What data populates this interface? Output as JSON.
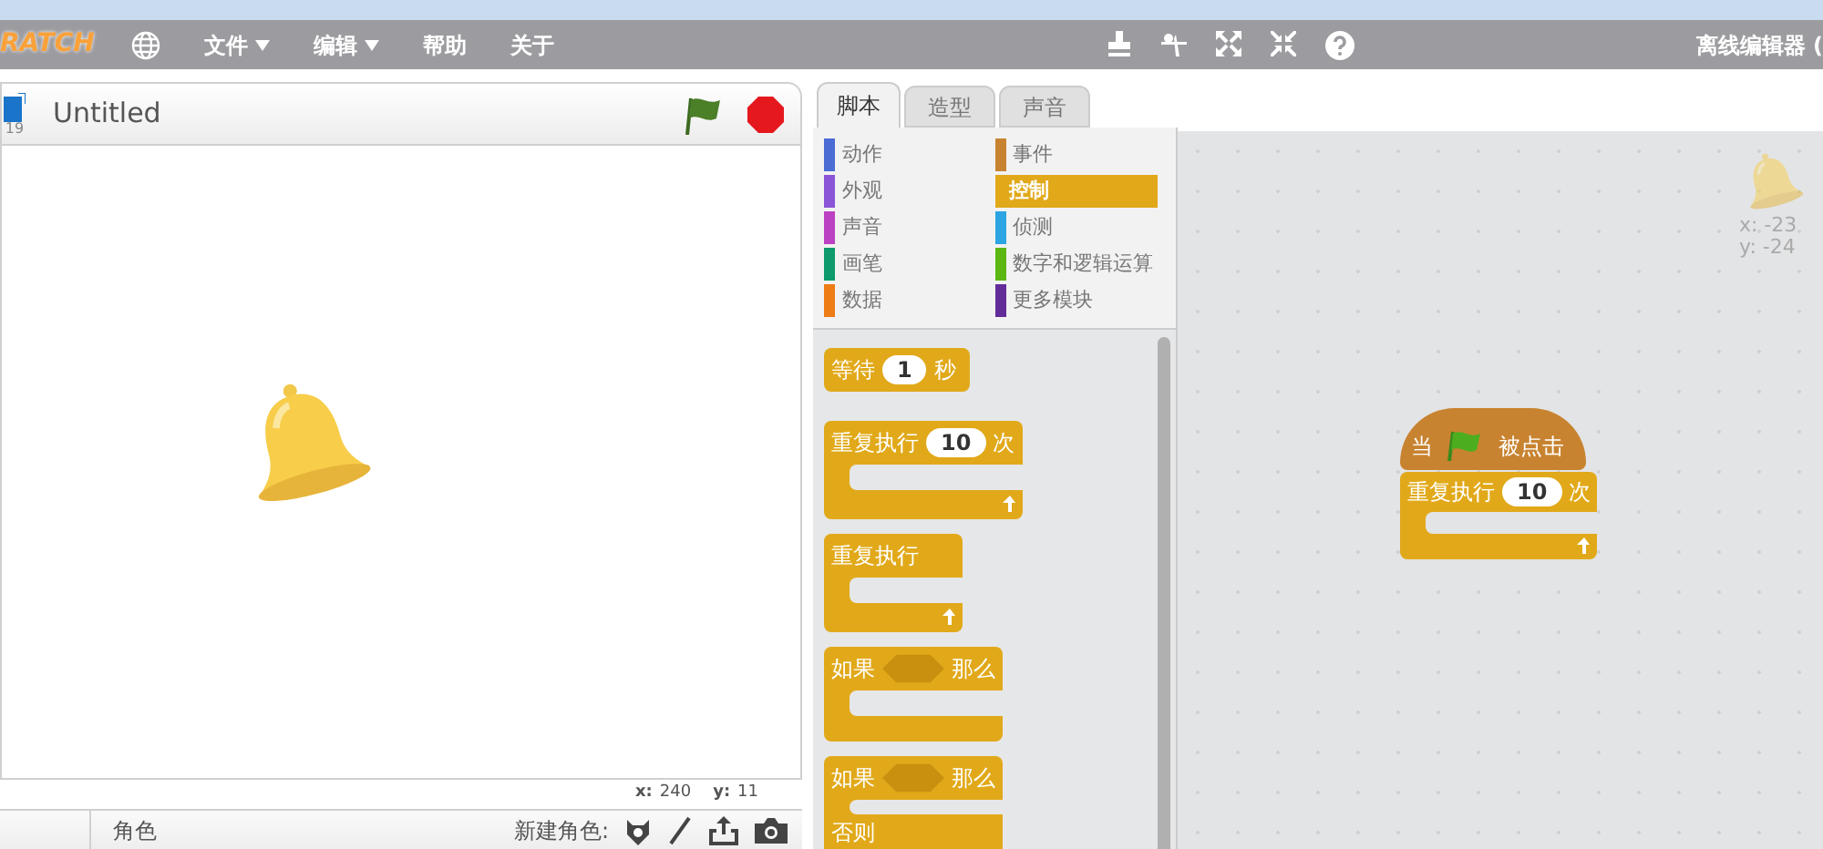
{
  "menu_bar": {
    "logo": "RATCH",
    "items": [
      {
        "label": "文件",
        "has_caret": true
      },
      {
        "label": "编辑",
        "has_caret": true
      },
      {
        "label": "帮助",
        "has_caret": false
      },
      {
        "label": "关于",
        "has_caret": false
      }
    ],
    "right_label": "离线编辑器 ("
  },
  "stage": {
    "title": "Untitled",
    "version": "19",
    "x_label": "x:",
    "x_value": "240",
    "y_label": "y:",
    "y_value": "11"
  },
  "sprite_bar": {
    "label": "角色",
    "new_sprite": "新建角色:"
  },
  "tabs": [
    {
      "label": "脚本",
      "selected": true
    },
    {
      "label": "造型",
      "selected": false
    },
    {
      "label": "声音",
      "selected": false
    }
  ],
  "categories": [
    {
      "label": "动作",
      "color": "#4a6cd4",
      "selected": false
    },
    {
      "label": "事件",
      "color": "#c88330",
      "selected": false
    },
    {
      "label": "外观",
      "color": "#8a55d7",
      "selected": false
    },
    {
      "label": "控制",
      "color": "#e1a91a",
      "selected": true
    },
    {
      "label": "声音",
      "color": "#bb42c3",
      "selected": false
    },
    {
      "label": "侦测",
      "color": "#2ca5e2",
      "selected": false
    },
    {
      "label": "画笔",
      "color": "#0e9a6c",
      "selected": false
    },
    {
      "label": "数字和逻辑运算",
      "color": "#5cb712",
      "selected": false
    },
    {
      "label": "数据",
      "color": "#ee7d16",
      "selected": false
    },
    {
      "label": "更多模块",
      "color": "#632d99",
      "selected": false
    }
  ],
  "palette_blocks": [
    {
      "kind": "stack",
      "label": "等待",
      "input": "1",
      "suffix": "秒"
    },
    {
      "kind": "c",
      "label": "重复执行",
      "input": "10",
      "suffix": "次"
    },
    {
      "kind": "c",
      "label": "重复执行"
    },
    {
      "kind": "if",
      "label": "如果",
      "suffix": "那么"
    },
    {
      "kind": "ifelse",
      "label": "如果",
      "suffix": "那么",
      "else_label": "否则"
    }
  ],
  "script": {
    "hat_label": "当",
    "hat_suffix": "被点击",
    "loop_label": "重复执行",
    "loop_input": "10",
    "loop_suffix": "次"
  },
  "sprite_position": {
    "x": "x: -23",
    "y": "y: -24"
  }
}
